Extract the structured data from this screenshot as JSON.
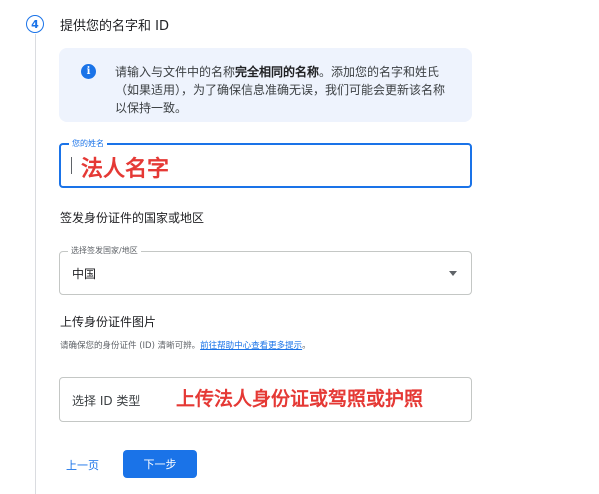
{
  "step": {
    "number": "4",
    "title": "提供您的名字和 ID"
  },
  "info": {
    "icon": "info-icon",
    "icon_glyph": "i",
    "text_before": "请输入与文件中的名称",
    "text_bold": "完全相同的名称",
    "text_after": "。添加您的名字和姓氏（如果适用），为了确保信息准确无误，我们可能会更新该名称以保持一致。"
  },
  "name_field": {
    "label": "您的姓名",
    "value": "",
    "overlay": "法人名字"
  },
  "country_section": {
    "heading": "签发身份证件的国家或地区",
    "field_label": "选择签发国家/地区",
    "value": "中国"
  },
  "id_section": {
    "heading": "上传身份证件图片",
    "helper_text": "请确保您的身份证件 (ID) 清晰可辨。",
    "helper_link": "前往帮助中心查看更多提示",
    "helper_end": "。",
    "type_placeholder": "选择 ID 类型",
    "overlay": "上传法人身份证或驾照或护照"
  },
  "nav": {
    "prev_label": "上一页",
    "next_label": "下一步"
  },
  "colors": {
    "accent": "#1a73e8",
    "annotation_red": "#e53935",
    "info_bg": "#eef3fd"
  }
}
